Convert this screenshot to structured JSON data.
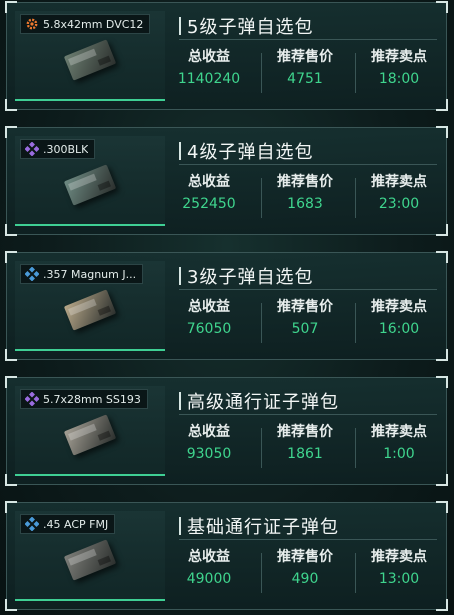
{
  "packs": [
    {
      "item_name": "5.8x42mm DVC12",
      "tier_icon": "orange-gear-icon",
      "tier_color": "#f07a2f",
      "box_color": "#6d7f72",
      "title": "5级子弹自选包",
      "stats": [
        {
          "label": "总收益",
          "value": "1140240"
        },
        {
          "label": "推荐售价",
          "value": "4751"
        },
        {
          "label": "推荐卖点",
          "value": "18:00"
        }
      ]
    },
    {
      "item_name": ".300BLK",
      "tier_icon": "purple-diamond-icon",
      "tier_color": "#9a6ce0",
      "box_color": "#6f8c84",
      "title": "4级子弹自选包",
      "stats": [
        {
          "label": "总收益",
          "value": "252450"
        },
        {
          "label": "推荐售价",
          "value": "1683"
        },
        {
          "label": "推荐卖点",
          "value": "23:00"
        }
      ]
    },
    {
      "item_name": ".357 Magnum J...",
      "tier_icon": "blue-diamond-icon",
      "tier_color": "#4a9ad8",
      "box_color": "#b9a98a",
      "title": "3级子弹自选包",
      "stats": [
        {
          "label": "总收益",
          "value": "76050"
        },
        {
          "label": "推荐售价",
          "value": "507"
        },
        {
          "label": "推荐卖点",
          "value": "16:00"
        }
      ]
    },
    {
      "item_name": "5.7x28mm SS193",
      "tier_icon": "purple-diamond-icon",
      "tier_color": "#9a6ce0",
      "box_color": "#a6a196",
      "title": "高级通行证子弹包",
      "stats": [
        {
          "label": "总收益",
          "value": "93050"
        },
        {
          "label": "推荐售价",
          "value": "1861"
        },
        {
          "label": "推荐卖点",
          "value": "1:00"
        }
      ]
    },
    {
      "item_name": ".45 ACP FMJ",
      "tier_icon": "blue-diamond-icon",
      "tier_color": "#4a9ad8",
      "box_color": "#7e7f7a",
      "title": "基础通行证子弹包",
      "stats": [
        {
          "label": "总收益",
          "value": "49000"
        },
        {
          "label": "推荐售价",
          "value": "490"
        },
        {
          "label": "推荐卖点",
          "value": "13:00"
        }
      ]
    }
  ]
}
